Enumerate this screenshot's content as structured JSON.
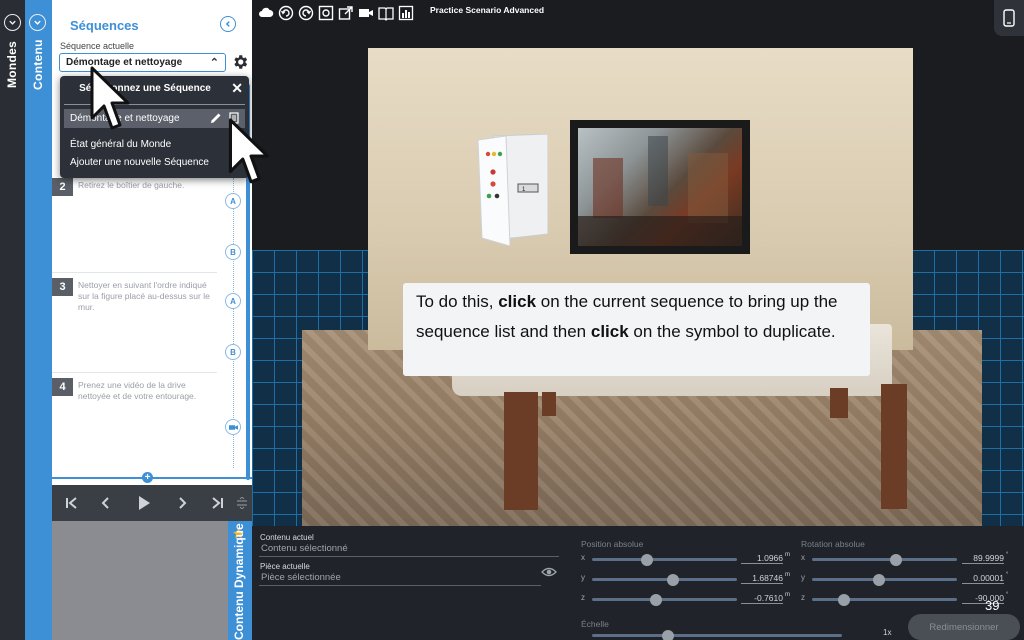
{
  "rails": {
    "mondes_label": "Mondes",
    "contenu_label": "Contenu",
    "dynamic_label": "Contenu Dynamique"
  },
  "sequences_panel": {
    "title": "Séquences",
    "current_label": "Séquence actuelle",
    "current_value": "Démontage et nettoyage",
    "steps": [
      {
        "num": "2",
        "text": "Retirez le boîtier de gauche."
      },
      {
        "num": "3",
        "text": "Nettoyer en suivant l'ordre indiqué sur la figure placé au-dessus sur le mur."
      },
      {
        "num": "4",
        "text": "Prenez une vidéo de la drive nettoyée et de votre entourage."
      }
    ],
    "bubbles": [
      "A",
      "B",
      "A",
      "B"
    ]
  },
  "dropdown": {
    "title": "Sélectionnez une Séquence",
    "selected_item": "Démontage et nettoyage",
    "items": [
      "État général du Monde",
      "Ajouter une nouvelle Séquence"
    ]
  },
  "toolbar": {
    "scenario_title": "Practice Scenario Advanced",
    "icons": [
      "cloud-icon",
      "undo-icon",
      "redo-icon",
      "focus-icon",
      "share-icon",
      "video-icon",
      "book-icon",
      "chart-icon"
    ]
  },
  "tooltip": {
    "part1": "To do this, ",
    "bold1": "click",
    "part2": " on the current sequence to bring up the sequence list and then ",
    "bold2": "click",
    "part3": " on the symbol to duplicate."
  },
  "properties": {
    "contenu_actuel_label": "Contenu actuel",
    "contenu_actuel_value": "Contenu sélectionné",
    "piece_actuelle_label": "Pièce actuelle",
    "piece_actuelle_value": "Pièce sélectionnée",
    "position_label": "Position absolue",
    "rotation_label": "Rotation absolue",
    "echelle_label": "Échelle",
    "axes": [
      "x",
      "y",
      "z"
    ],
    "position_values": [
      "1.0966",
      "1.68746",
      "-0.7610"
    ],
    "position_unit": "m",
    "rotation_values": [
      "89.9999",
      "0.00001",
      "-90.000"
    ],
    "rotation_unit": "°",
    "position_slider_fractions": [
      0.38,
      0.56,
      0.44
    ],
    "rotation_slider_fractions": [
      0.58,
      0.46,
      0.22
    ],
    "scale_value": "1x",
    "resize_button": "Redimensionner"
  },
  "page_number": "39",
  "colors": {
    "accent": "#3d8fd6",
    "panel_dark": "#20242a"
  }
}
